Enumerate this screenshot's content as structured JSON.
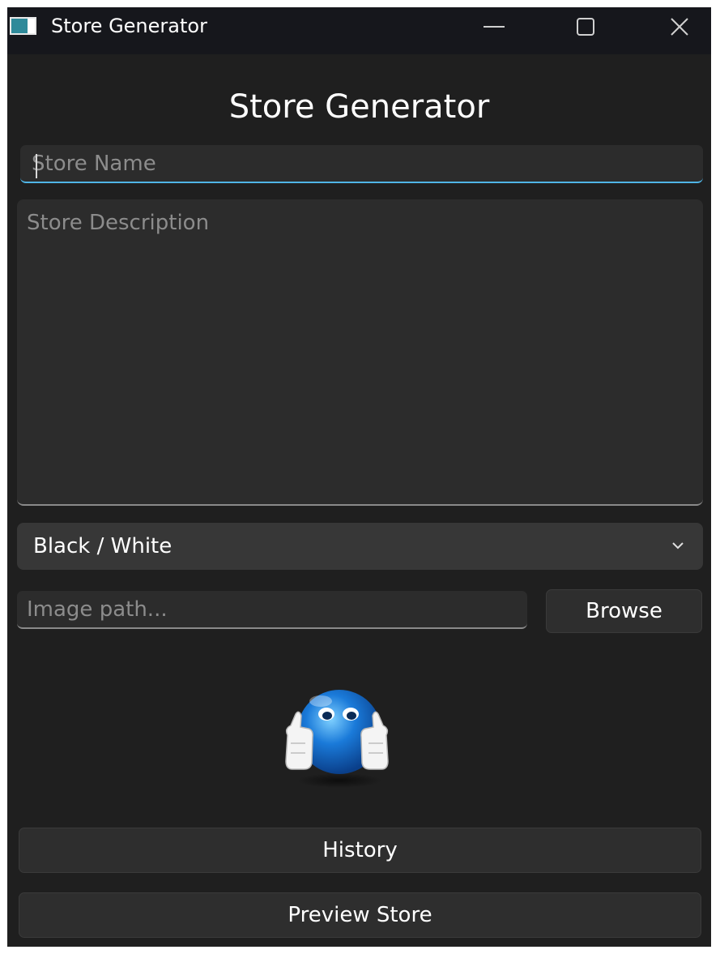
{
  "window": {
    "title": "Store Generator",
    "icons": {
      "app": "app-window-icon",
      "minimize": "minimize-icon",
      "maximize": "maximize-icon",
      "close": "close-icon"
    }
  },
  "main": {
    "heading": "Store Generator",
    "store_name": {
      "value": "",
      "placeholder": "Store Name"
    },
    "store_description": {
      "value": "",
      "placeholder": "Store Description"
    },
    "theme_select": {
      "selected": "Black / White",
      "icon": "chevron-down-icon"
    },
    "image_path": {
      "value": "",
      "placeholder": "Image path..."
    },
    "browse_label": "Browse",
    "mascot_icon": "thumbs-up-smiley-icon",
    "history_label": "History",
    "preview_label": "Preview Store"
  },
  "colors": {
    "window_bg": "#1f1f1f",
    "titlebar_bg": "#16171c",
    "input_bg": "#2c2c2c",
    "select_bg": "#373737",
    "focus_accent": "#4fb5e6",
    "placeholder": "#8c8c8c",
    "mascot_blue": "#1a7ad9"
  }
}
